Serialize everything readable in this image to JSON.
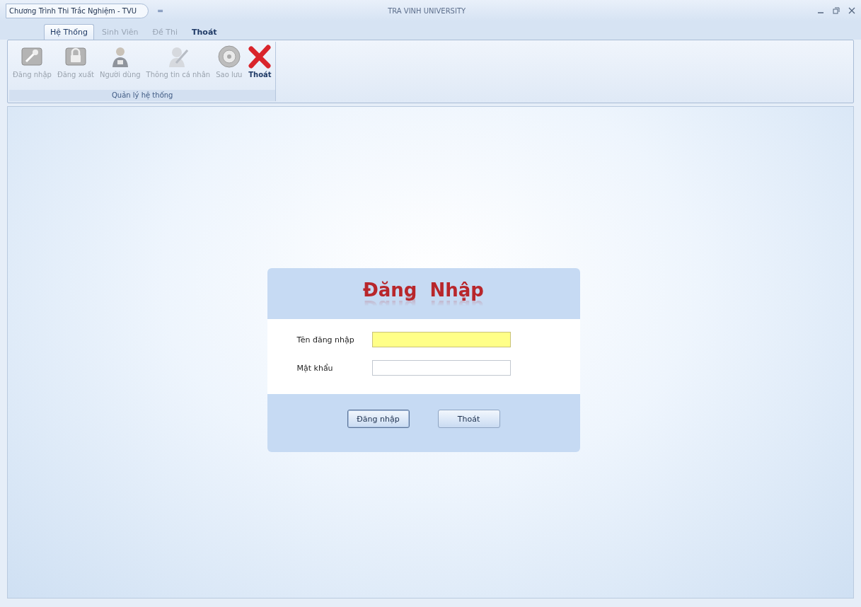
{
  "window": {
    "title": "Chương Trình Thi Trắc Nghiệm - TVU",
    "quick_access": "=",
    "caption": "TRA VINH UNIVERSITY"
  },
  "tabs": [
    {
      "label": "Hệ Thống",
      "selected": true,
      "disabled": false
    },
    {
      "label": "Sinh Viên",
      "selected": false,
      "disabled": true
    },
    {
      "label": "Đề Thi",
      "selected": false,
      "disabled": true
    },
    {
      "label": "Thoát",
      "selected": false,
      "disabled": false
    }
  ],
  "ribbon_group": {
    "label": "Quản lý hệ thống",
    "buttons": [
      {
        "kind": "key",
        "label": "Đăng nhập",
        "disabled": true
      },
      {
        "kind": "lock",
        "label": "Đăng xuất",
        "disabled": true
      },
      {
        "kind": "user",
        "label": "Người dùng",
        "disabled": true
      },
      {
        "kind": "profile",
        "label": "Thông tin cá nhân",
        "disabled": true
      },
      {
        "kind": "disc",
        "label": "Sao lưu",
        "disabled": true
      },
      {
        "kind": "exit",
        "label": "Thoát",
        "disabled": false
      }
    ]
  },
  "login_dialog": {
    "title": "Đăng  Nhập",
    "fields": [
      {
        "label": "Tên đăng nhập",
        "focused": true
      },
      {
        "label": "Mật khẩu",
        "focused": false
      }
    ],
    "buttons": [
      {
        "label": "Đăng nhập",
        "default": true
      },
      {
        "label": "Thoát",
        "default": false
      }
    ]
  }
}
